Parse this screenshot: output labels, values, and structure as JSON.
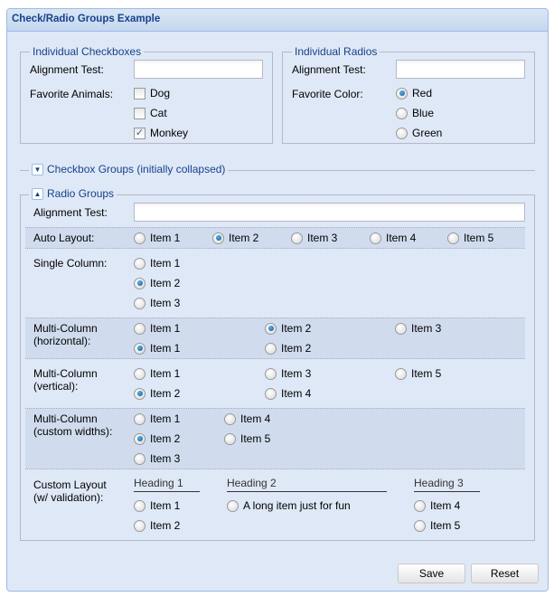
{
  "panel": {
    "title": "Check/Radio Groups Example"
  },
  "individual_checkboxes": {
    "legend": "Individual Checkboxes",
    "alignment_label": "Alignment Test:",
    "alignment_value": "",
    "animals_label": "Favorite Animals:",
    "items": [
      {
        "label": "Dog",
        "checked": false
      },
      {
        "label": "Cat",
        "checked": false
      },
      {
        "label": "Monkey",
        "checked": true
      }
    ]
  },
  "individual_radios": {
    "legend": "Individual Radios",
    "alignment_label": "Alignment Test:",
    "alignment_value": "",
    "color_label": "Favorite Color:",
    "items": [
      {
        "label": "Red",
        "checked": true
      },
      {
        "label": "Blue",
        "checked": false
      },
      {
        "label": "Green",
        "checked": false
      }
    ]
  },
  "checkbox_groups": {
    "legend": "Checkbox Groups (initially collapsed)",
    "collapsed": true
  },
  "radio_groups": {
    "legend": "Radio Groups",
    "collapsed": false,
    "alignment_label": "Alignment Test:",
    "alignment_value": "",
    "auto_layout": {
      "label": "Auto Layout:",
      "items": [
        "Item 1",
        "Item 2",
        "Item 3",
        "Item 4",
        "Item 5"
      ],
      "selected": "Item 2"
    },
    "single_column": {
      "label": "Single Column:",
      "items": [
        "Item 1",
        "Item 2",
        "Item 3"
      ],
      "selected": "Item 2"
    },
    "multi_horizontal": {
      "label1": "Multi-Column",
      "label2": "(horizontal):",
      "items": [
        "Item 1",
        "Item 2",
        "Item 3",
        "Item 1",
        "Item 2"
      ],
      "selected_index": [
        1,
        3
      ]
    },
    "multi_vertical": {
      "label1": "Multi-Column",
      "label2": "(vertical):",
      "items": [
        "Item 1",
        "Item 2",
        "Item 3",
        "Item 4",
        "Item 5"
      ],
      "selected": "Item 2"
    },
    "multi_custom": {
      "label1": "Multi-Column",
      "label2": "(custom widths):",
      "items": [
        "Item 1",
        "Item 2",
        "Item 3",
        "Item 4",
        "Item 5"
      ],
      "selected": "Item 2"
    },
    "custom_layout": {
      "label1": "Custom Layout",
      "label2": "(w/ validation):",
      "headings": [
        "Heading 1",
        "Heading 2",
        "Heading 3"
      ],
      "col1": [
        "Item 1",
        "Item 2"
      ],
      "col2": [
        "A long item just for fun"
      ],
      "col3": [
        "Item 4",
        "Item 5"
      ]
    }
  },
  "buttons": {
    "save": "Save",
    "reset": "Reset"
  }
}
